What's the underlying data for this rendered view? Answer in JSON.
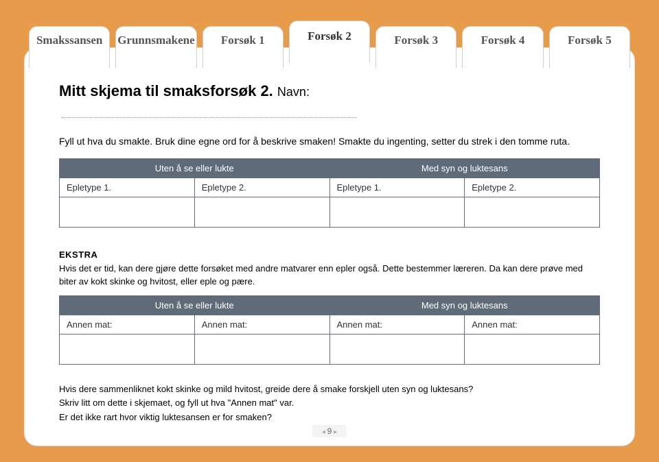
{
  "tabs": {
    "t0": "Smakssansen",
    "t1": "Grunnsmakene",
    "t2": "Forsøk 1",
    "t3": "Forsøk 2",
    "t4": "Forsøk 3",
    "t5": "Forsøk 4",
    "t6": "Forsøk 5"
  },
  "title": "Mitt skjema til smaksforsøk 2.",
  "title_suffix": "Navn:",
  "intro": "Fyll ut hva du smakte. Bruk dine egne ord for å beskrive smaken! Smakte du ingenting, setter du strek i den tomme ruta.",
  "table1": {
    "h1": "Uten å se eller lukte",
    "h2": "Med syn og luktesans",
    "c1": "Epletype 1.",
    "c2": "Epletype 2.",
    "c3": "Epletype 1.",
    "c4": "Epletype 2."
  },
  "extra_label": "EKSTRA",
  "extra_text": "Hvis det er tid, kan dere gjøre dette forsøket med andre matvarer enn epler også. Dette bestemmer læreren. Da kan dere prøve med biter av kokt skinke og hvitost, eller eple og pære.",
  "table2": {
    "h1": "Uten å se eller lukte",
    "h2": "Med syn og luktesans",
    "c1": "Annen mat:",
    "c2": "Annen mat:",
    "c3": "Annen mat:",
    "c4": "Annen mat:"
  },
  "footer1": "Hvis dere sammenliknet kokt skinke og mild hvitost, greide dere å smake forskjell uten syn og luktesans?",
  "footer2": "Skriv litt om dette i skjemaet, og fyll ut hva \"Annen mat\" var.",
  "footer3": "Er det ikke rart hvor viktig luktesansen er for smaken?",
  "pagenum": "9"
}
